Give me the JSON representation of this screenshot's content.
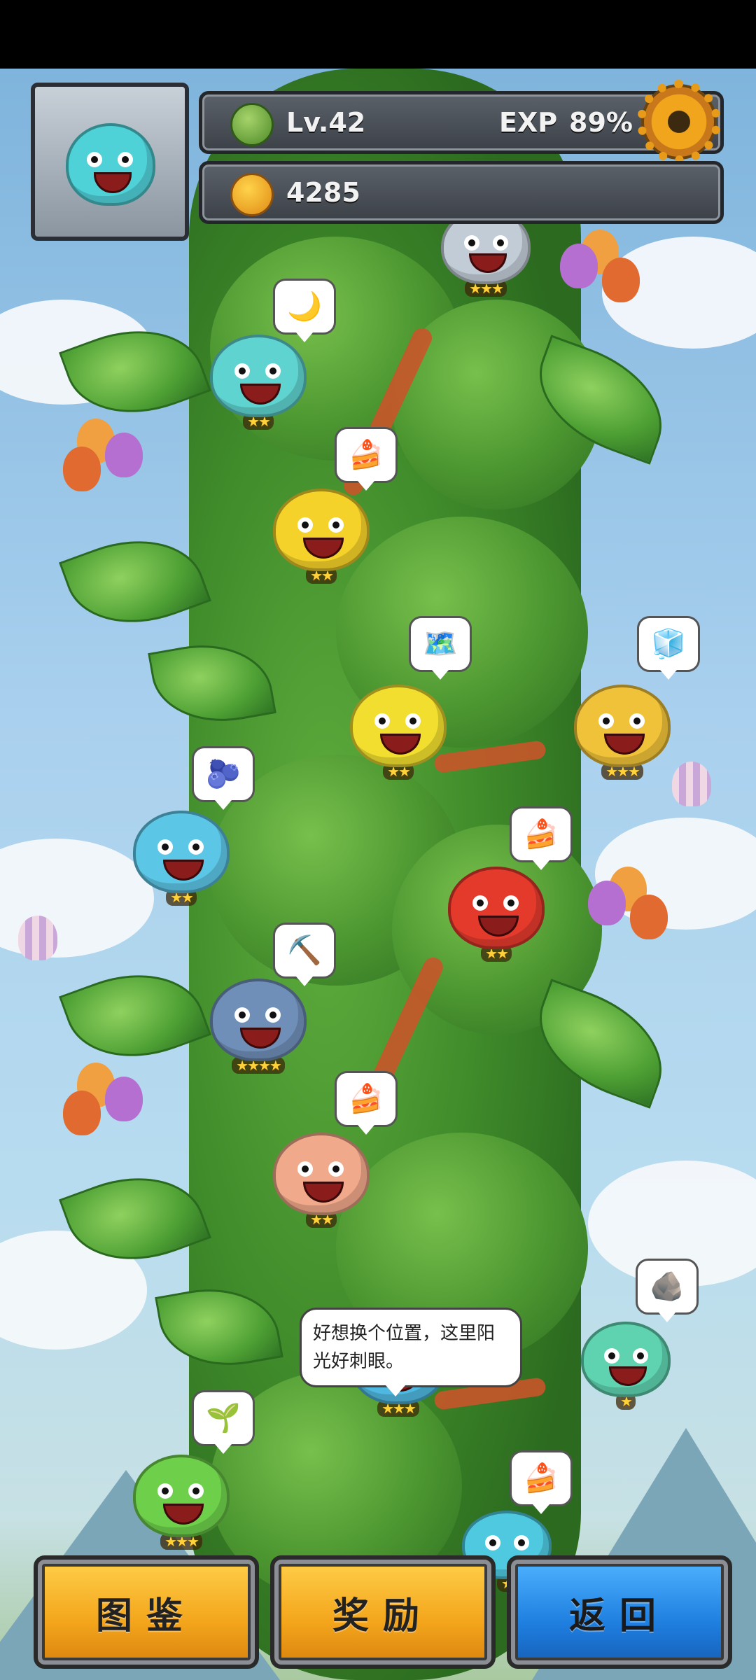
{
  "hud": {
    "level": "Lv.42",
    "exp_label": "EXP",
    "exp_value": "89%",
    "currency": "4285"
  },
  "speech_bubble": "好想换个位置，这里阳光好刺眼。",
  "monsters": [
    {
      "name": "top-left-monster",
      "stars": "★★★"
    },
    {
      "name": "top-right-monster",
      "stars": "★★★"
    },
    {
      "name": "spiky-helmet-monster",
      "stars": "★★"
    },
    {
      "name": "pirate-yellow-monster",
      "stars": "★★"
    },
    {
      "name": "purple-hat-monster",
      "stars": "★★"
    },
    {
      "name": "monkey-king-monster",
      "stars": "★★★"
    },
    {
      "name": "goggles-monster",
      "stars": "★★"
    },
    {
      "name": "flame-red-monster",
      "stars": "★★"
    },
    {
      "name": "ice-demon-monster",
      "stars": "★★★★"
    },
    {
      "name": "flower-crab-monster",
      "stars": "★★"
    },
    {
      "name": "pirate-captain-monster",
      "stars": "★★★"
    },
    {
      "name": "top-hat-monster",
      "stars": "★"
    },
    {
      "name": "tribal-green-monster",
      "stars": "★★★"
    },
    {
      "name": "bottom-blue-monster",
      "stars": "★"
    }
  ],
  "buttons": {
    "collection": "图鉴",
    "rewards": "奖励",
    "back": "返回"
  },
  "colors": {
    "gold_button": "#f3a51b",
    "blue_button": "#1f7fe0",
    "sky": "#a9d0ee",
    "vine": "#4ea034"
  }
}
